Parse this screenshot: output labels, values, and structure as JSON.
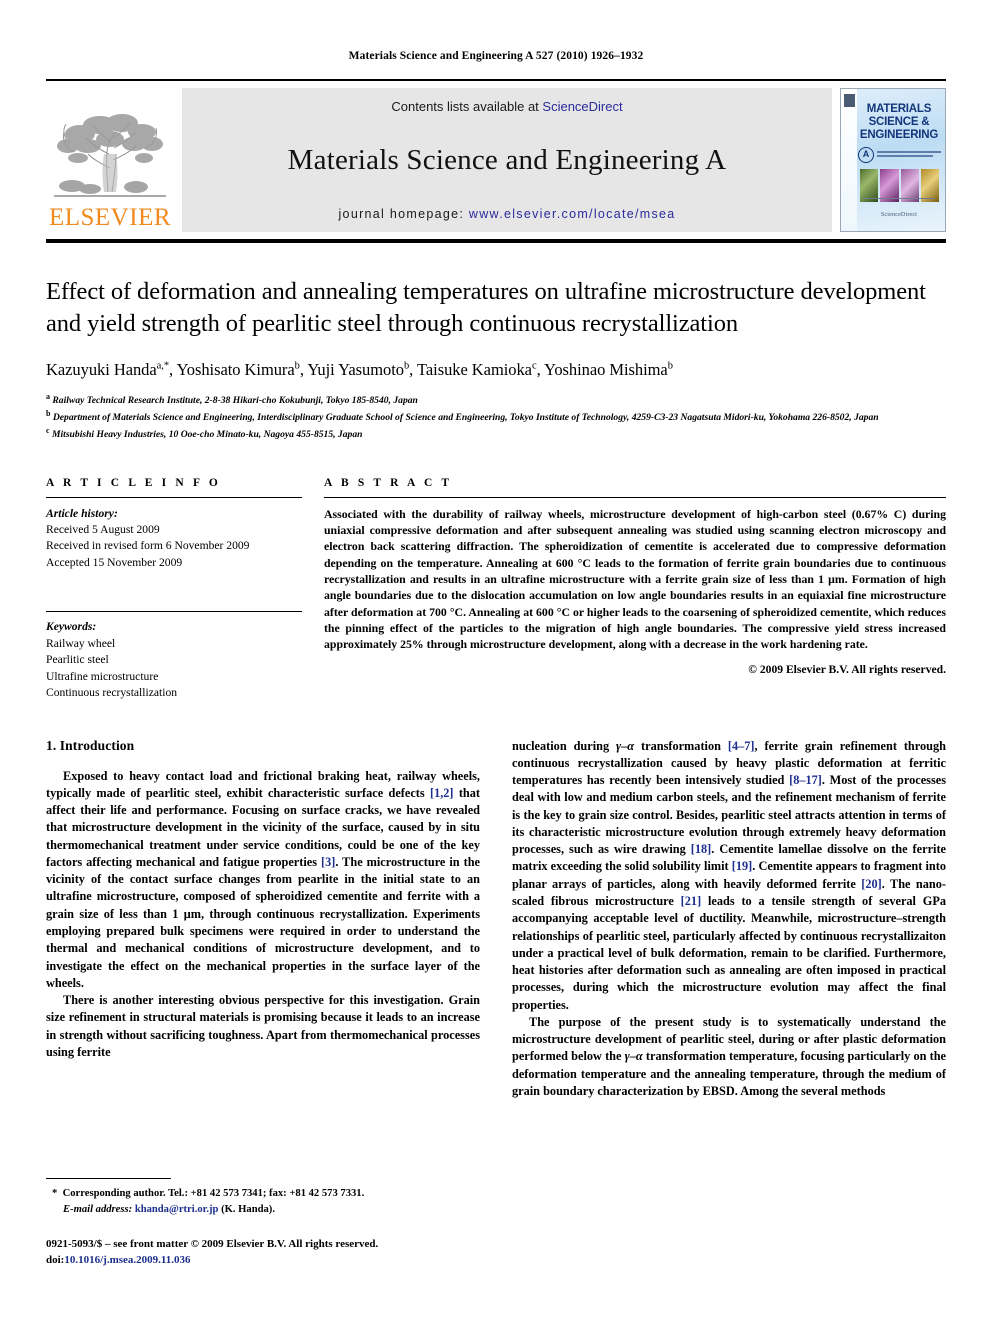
{
  "running_head": "Materials Science and Engineering A 527 (2010) 1926–1932",
  "masthead": {
    "publisher_name": "ELSEVIER",
    "contents_prefix": "Contents lists available at ",
    "contents_link": "ScienceDirect",
    "journal_title": "Materials Science and Engineering A",
    "homepage_prefix": "journal homepage: ",
    "homepage_url": "www.elsevier.com/locate/msea",
    "cover": {
      "line1": "MATERIALS",
      "line2": "SCIENCE &",
      "line3": "ENGINEERING",
      "badge": "A",
      "footer": "ScienceDirect"
    }
  },
  "article": {
    "title": "Effect of deformation and annealing temperatures on ultrafine microstructure development and yield strength of pearlitic steel through continuous recrystallization",
    "authors_html": "Kazuyuki Handa<sup>a,*</sup>, Yoshisato Kimura<sup>b</sup>, Yuji Yasumoto<sup>b</sup>, Taisuke Kamioka<sup>c</sup>, Yoshinao Mishima<sup>b</sup>",
    "affiliations": [
      {
        "marker": "a",
        "text": "Railway Technical Research Institute, 2-8-38 Hikari-cho Kokubunji, Tokyo 185-8540, Japan"
      },
      {
        "marker": "b",
        "text": "Department of Materials Science and Engineering, Interdisciplinary Graduate School of Science and Engineering, Tokyo Institute of Technology, 4259-C3-23 Nagatsuta Midori-ku, Yokohama 226-8502, Japan"
      },
      {
        "marker": "c",
        "text": "Mitsubishi Heavy Industries, 10 Ooe-cho Minato-ku, Nagoya 455-8515, Japan"
      }
    ]
  },
  "article_info": {
    "heading": "A R T I C L E   I N F O",
    "history_label": "Article history:",
    "history": [
      "Received 5 August 2009",
      "Received in revised form 6 November 2009",
      "Accepted 15 November 2009"
    ],
    "keywords_label": "Keywords:",
    "keywords": [
      "Railway wheel",
      "Pearlitic steel",
      "Ultrafine microstructure",
      "Continuous recrystallization"
    ]
  },
  "abstract": {
    "heading": "A B S T R A C T",
    "text": "Associated with the durability of railway wheels, microstructure development of high-carbon steel (0.67% C) during uniaxial compressive deformation and after subsequent annealing was studied using scanning electron microscopy and electron back scattering diffraction. The spheroidization of cementite is accelerated due to compressive deformation depending on the temperature. Annealing at 600 °C leads to the formation of ferrite grain boundaries due to continuous recrystallization and results in an ultrafine microstructure with a ferrite grain size of less than 1 μm. Formation of high angle boundaries due to the dislocation accumulation on low angle boundaries results in an equiaxial fine microstructure after deformation at 700 °C. Annealing at 600 °C or higher leads to the coarsening of spheroidized cementite, which reduces the pinning effect of the particles to the migration of high angle boundaries. The compressive yield stress increased approximately 25% through microstructure development, along with a decrease in the work hardening rate.",
    "copyright": "© 2009 Elsevier B.V. All rights reserved."
  },
  "body": {
    "section_number_title": "1.  Introduction",
    "left_paragraphs": [
      "Exposed to heavy contact load and frictional braking heat, railway wheels, typically made of pearlitic steel, exhibit characteristic surface defects <span class=\"cite\">[1,2]</span> that affect their life and performance. Focusing on surface cracks, we have revealed that microstructure development in the vicinity of the surface, caused by in situ thermomechanical treatment under service conditions, could be one of the key factors affecting mechanical and fatigue properties <span class=\"cite\">[3]</span>. The microstructure in the vicinity of the contact surface changes from pearlite in the initial state to an ultrafine microstructure, composed of spheroidized cementite and ferrite with a grain size of less than 1 μm, through continuous recrystallization. Experiments employing prepared bulk specimens were required in order to understand the thermal and mechanical conditions of microstructure development, and to investigate the effect on the mechanical properties in the surface layer of the wheels.",
      "There is another interesting obvious perspective for this investigation. Grain size refinement in structural materials is promising because it leads to an increase in strength without sacrificing toughness. Apart from thermomechanical processes using ferrite"
    ],
    "right_paragraphs": [
      "nucleation during <i>γ–α</i> transformation <span class=\"cite\">[4–7]</span>, ferrite grain refinement through continuous recrystallization caused by heavy plastic deformation at ferritic temperatures has recently been intensively studied <span class=\"cite\">[8–17]</span>. Most of the processes deal with low and medium carbon steels, and the refinement mechanism of ferrite is the key to grain size control. Besides, pearlitic steel attracts attention in terms of its characteristic microstructure evolution through extremely heavy deformation processes, such as wire drawing <span class=\"cite\">[18]</span>. Cementite lamellae dissolve on the ferrite matrix exceeding the solid solubility limit <span class=\"cite\">[19]</span>. Cementite appears to fragment into planar arrays of particles, along with heavily deformed ferrite <span class=\"cite\">[20]</span>. The nano-scaled fibrous microstructure <span class=\"cite\">[21]</span> leads to a tensile strength of several GPa accompanying acceptable level of ductility. Meanwhile, microstructure–strength relationships of pearlitic steel, particularly affected by continuous recrystallizaiton under a practical level of bulk deformation, remain to be clarified. Furthermore, heat histories after deformation such as annealing are often imposed in practical processes, during which the microstructure evolution may affect the final properties.",
      "The purpose of the present study is to systematically understand the microstructure development of pearlitic steel, during or after plastic deformation performed below the <i>γ–α</i> transformation temperature, focusing particularly on the deformation temperature and the annealing temperature, through the medium of grain boundary characterization by EBSD. Among the several methods"
    ]
  },
  "footnotes": {
    "corresponding": "Corresponding author. Tel.: +81 42 573 7341; fax: +81 42 573 7331.",
    "email_label": "E-mail address:",
    "email": "khanda@rtri.or.jp",
    "email_suffix": "(K. Handa).",
    "issn_line": "0921-5093/$ – see front matter © 2009 Elsevier B.V. All rights reserved.",
    "doi_label": "doi:",
    "doi_value": "10.1016/j.msea.2009.11.036"
  }
}
